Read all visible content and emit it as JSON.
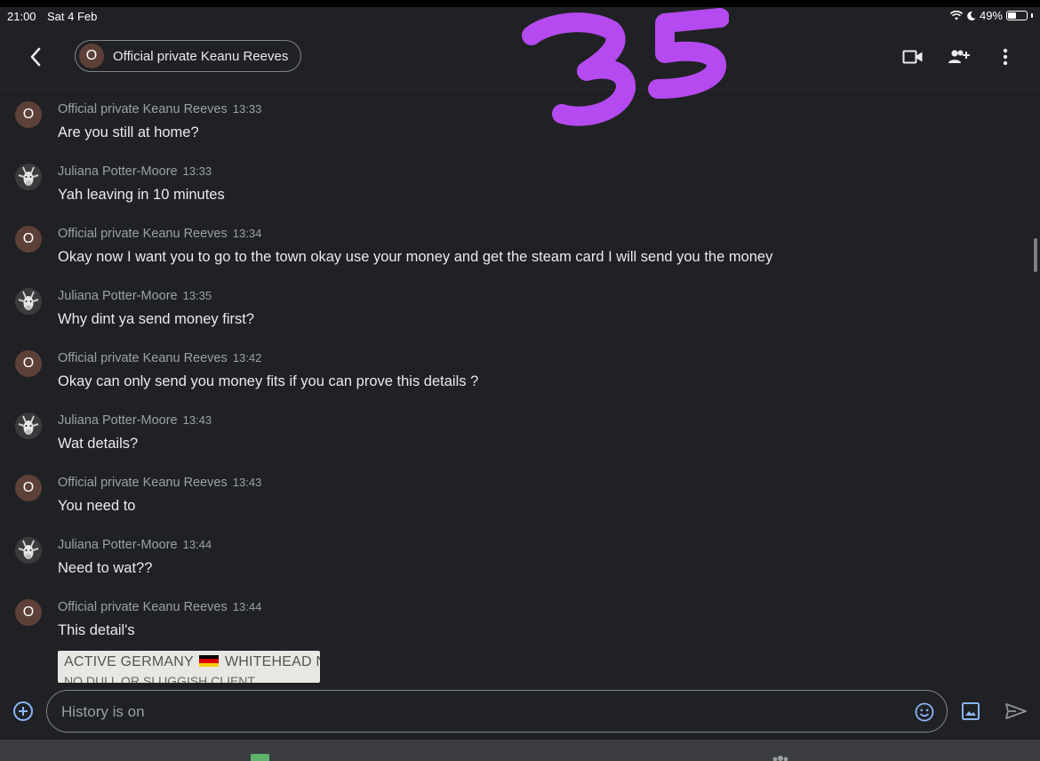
{
  "status_bar": {
    "time": "21:00",
    "date": "Sat 4 Feb",
    "battery": "49%",
    "battery_level": 0.49,
    "icons": [
      "wifi-icon",
      "moon-icon",
      "battery-icon"
    ]
  },
  "header": {
    "back_icon": "chevron-left-icon",
    "contact_initial": "O",
    "contact_name": "Official private Keanu Reeves",
    "actions": [
      "video-call-icon",
      "add-people-icon",
      "more-vert-icon"
    ]
  },
  "messages": [
    {
      "sender": "Official private Keanu Reeves",
      "initial": "O",
      "avatar": "initial",
      "time": "13:33",
      "text": "Are you still at home?"
    },
    {
      "sender": "Juliana Potter-Moore",
      "initial": "",
      "avatar": "photo",
      "time": "13:33",
      "text": "Yah leaving in 10 minutes"
    },
    {
      "sender": "Official private Keanu Reeves",
      "initial": "O",
      "avatar": "initial",
      "time": "13:34",
      "text": "Okay now I want you to go to the town okay use your money and get the steam card I will send you the money"
    },
    {
      "sender": "Juliana Potter-Moore",
      "initial": "",
      "avatar": "photo",
      "time": "13:35",
      "text": "Why dint ya send money first?"
    },
    {
      "sender": "Official private Keanu Reeves",
      "initial": "O",
      "avatar": "initial",
      "time": "13:42",
      "text": "Okay can only send you money fits if you can prove this details ?"
    },
    {
      "sender": "Juliana Potter-Moore",
      "initial": "",
      "avatar": "photo",
      "time": "13:43",
      "text": "Wat details?"
    },
    {
      "sender": "Official private Keanu Reeves",
      "initial": "O",
      "avatar": "initial",
      "time": "13:43",
      "text": "You need to"
    },
    {
      "sender": "Juliana Potter-Moore",
      "initial": "",
      "avatar": "photo",
      "time": "13:44",
      "text": "Need to wat??"
    },
    {
      "sender": "Official private Keanu Reeves",
      "initial": "O",
      "avatar": "initial",
      "time": "13:44",
      "text": "This detail's"
    }
  ],
  "attachment": {
    "line1_a": "ACTIVE GERMANY",
    "line1_b": "WHITEHEAD N",
    "line2": "NO DULL OR SLUGGISH CLIENT"
  },
  "composer": {
    "placeholder": "History is on",
    "icons": [
      "add-circle-icon",
      "emoji-icon",
      "image-icon",
      "send-icon"
    ]
  },
  "annotation": {
    "text": "35",
    "color": "#b44af0"
  },
  "colors": {
    "background": "#202124",
    "text": "#e8eaed",
    "muted": "#9aa0a6",
    "accent": "#8ab4f8",
    "avatar_initial_bg": "#5d4037"
  }
}
